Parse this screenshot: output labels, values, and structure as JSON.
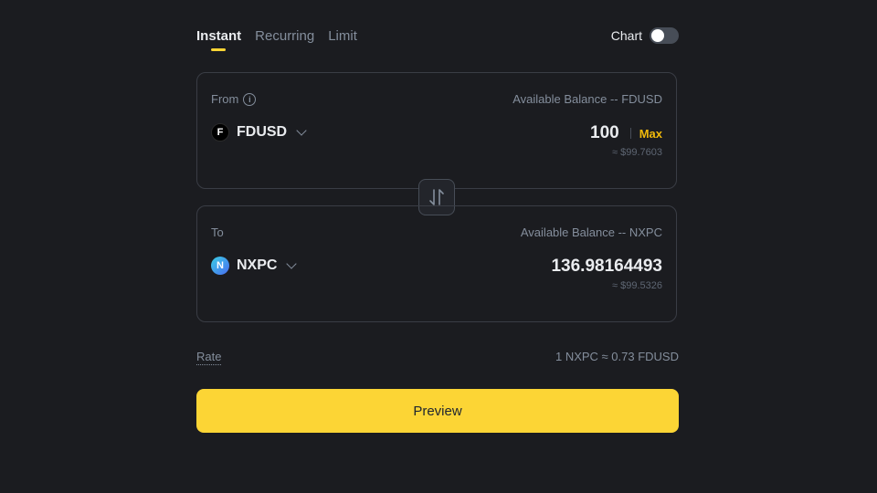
{
  "tabs": [
    {
      "label": "Instant",
      "active": true
    },
    {
      "label": "Recurring",
      "active": false
    },
    {
      "label": "Limit",
      "active": false
    }
  ],
  "chart_toggle": {
    "label": "Chart",
    "enabled": false
  },
  "from": {
    "label": "From",
    "balance_text": "Available Balance -- FDUSD",
    "coin": "FDUSD",
    "coin_icon_letter": "F",
    "amount": "100",
    "max_label": "Max",
    "fiat_value": "≈ $99.7603"
  },
  "to": {
    "label": "To",
    "balance_text": "Available Balance -- NXPC",
    "coin": "NXPC",
    "coin_icon_letter": "N",
    "amount": "136.98164493",
    "fiat_value": "≈ $99.5326"
  },
  "rate": {
    "label": "Rate",
    "value": "1 NXPC ≈ 0.73 FDUSD"
  },
  "preview_button": "Preview",
  "colors": {
    "accent": "#fcd535",
    "max": "#f0b90b",
    "background": "#1b1c20"
  },
  "icons": {
    "info": "info-icon",
    "swap": "swap-arrows-icon",
    "chevron": "chevron-down-icon"
  }
}
